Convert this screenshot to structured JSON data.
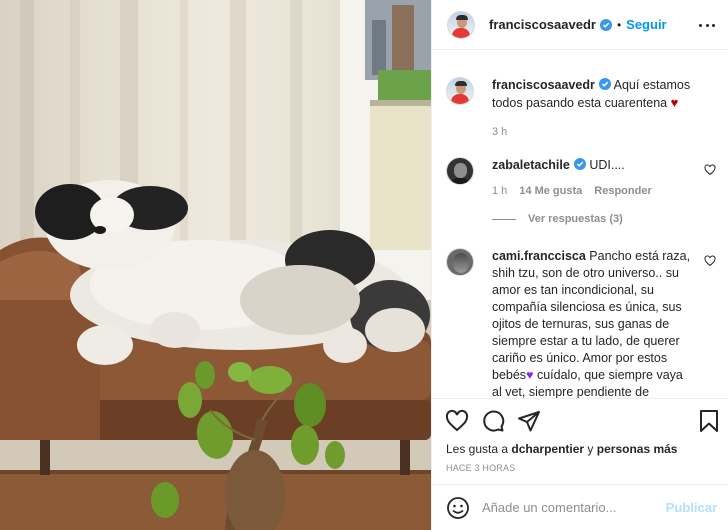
{
  "post": {
    "image_alt": "Shih tzu dog lying on a brown leather sofa with a bonsai plant in front"
  },
  "header": {
    "username": "franciscosaavedr",
    "separator": "•",
    "follow_label": "Seguir"
  },
  "caption": {
    "username": "franciscosaavedr",
    "text": "Aquí estamos todos pasando esta cuarentena",
    "emoji": "♥",
    "time": "3 h"
  },
  "comments": [
    {
      "username": "zabaletachile",
      "text": "UDI....",
      "time": "1 h",
      "likes": "14 Me gusta",
      "reply_label": "Responder",
      "view_replies": "Ver respuestas (3)"
    },
    {
      "username": "cami.franccisca",
      "text": "Pancho está raza, shih tzu, son de otro universo.. su amor es tan incondicional, su compañía silenciosa es única, sus ojitos de ternuras, sus ganas de siempre estar a tu lado, de querer cariño es único. Amor por estos bebés",
      "emoji": "♥",
      "text_after": " cuídalo, que siempre vaya al vet, siempre pendiente de"
    }
  ],
  "actions": {
    "likes_prefix": "Les gusta a",
    "liker": "dcharpentier",
    "likes_conj": "y",
    "likes_rest": "personas más",
    "time": "HACE 3 HORAS"
  },
  "add_comment": {
    "placeholder": "Añade un comentario...",
    "post_label": "Publicar"
  },
  "colors": {
    "link_blue": "#0095f6",
    "post_disabled": "#b2dffc",
    "secondary_text": "#8e8e8e"
  },
  "icons": [
    "verified-badge-icon",
    "more-options-icon",
    "heart-icon",
    "comment-icon",
    "share-icon",
    "bookmark-icon",
    "emoji-icon"
  ]
}
